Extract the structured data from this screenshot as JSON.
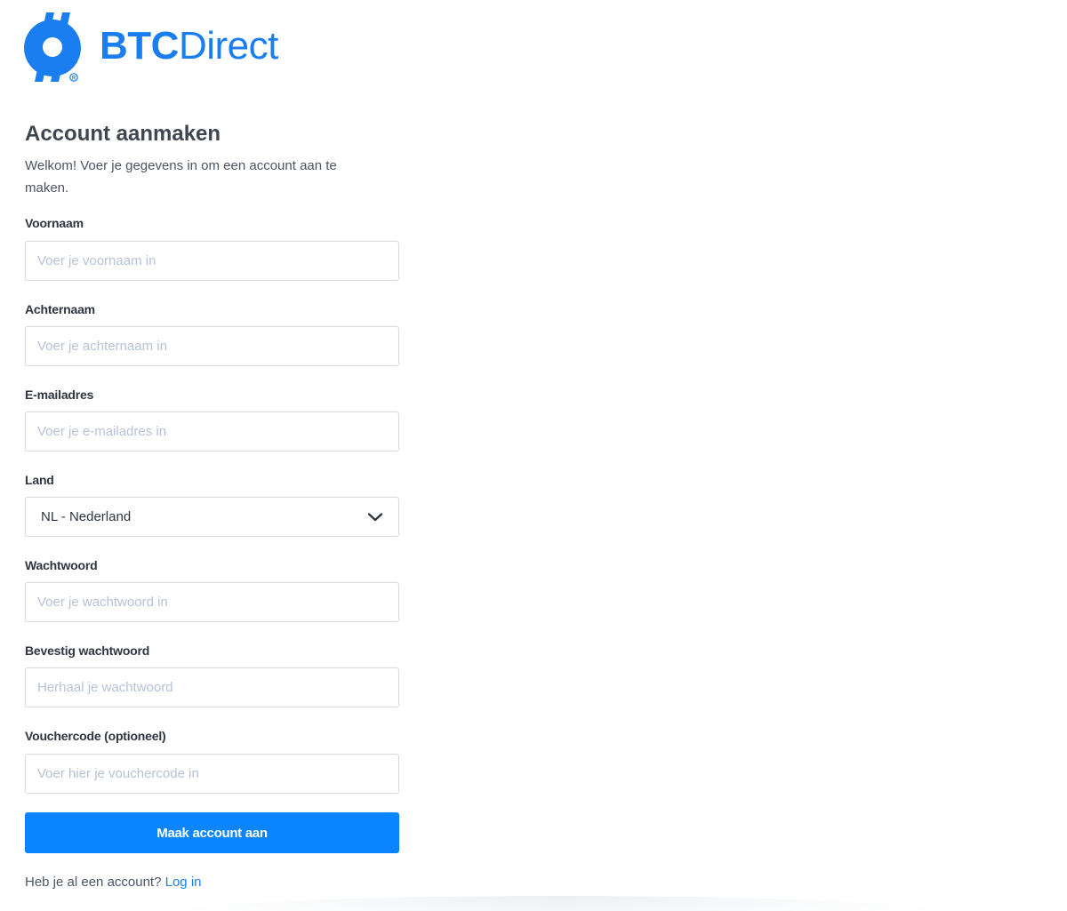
{
  "brand": {
    "name_bold": "BTC",
    "name_light": "Direct",
    "color": "#1a7ef0",
    "icon": "btc-direct-logo-icon"
  },
  "form": {
    "title": "Account aanmaken",
    "intro": "Welkom! Voer je gegevens in om een account aan te maken.",
    "fields": {
      "first_name": {
        "label": "Voornaam",
        "value": "",
        "placeholder": "Voer je voornaam in"
      },
      "last_name": {
        "label": "Achternaam",
        "value": "",
        "placeholder": "Voer je achternaam in"
      },
      "email": {
        "label": "E-mailadres",
        "value": "",
        "placeholder": "Voer je e-mailadres in"
      },
      "country": {
        "label": "Land",
        "selected": "NL - Nederland",
        "icon": "chevron-down-icon"
      },
      "password": {
        "label": "Wachtwoord",
        "value": "",
        "placeholder": "Voer je wachtwoord in"
      },
      "confirm_password": {
        "label": "Bevestig wachtwoord",
        "value": "",
        "placeholder": "Herhaal je wachtwoord"
      },
      "voucher": {
        "label": "Vouchercode (optioneel)",
        "value": "",
        "placeholder": "Voer hier je vouchercode in"
      }
    },
    "submit_label": "Maak account aan",
    "submit_color": "#0a84ff",
    "login_prompt": "Heb je al een account?",
    "login_link": "Log in"
  }
}
